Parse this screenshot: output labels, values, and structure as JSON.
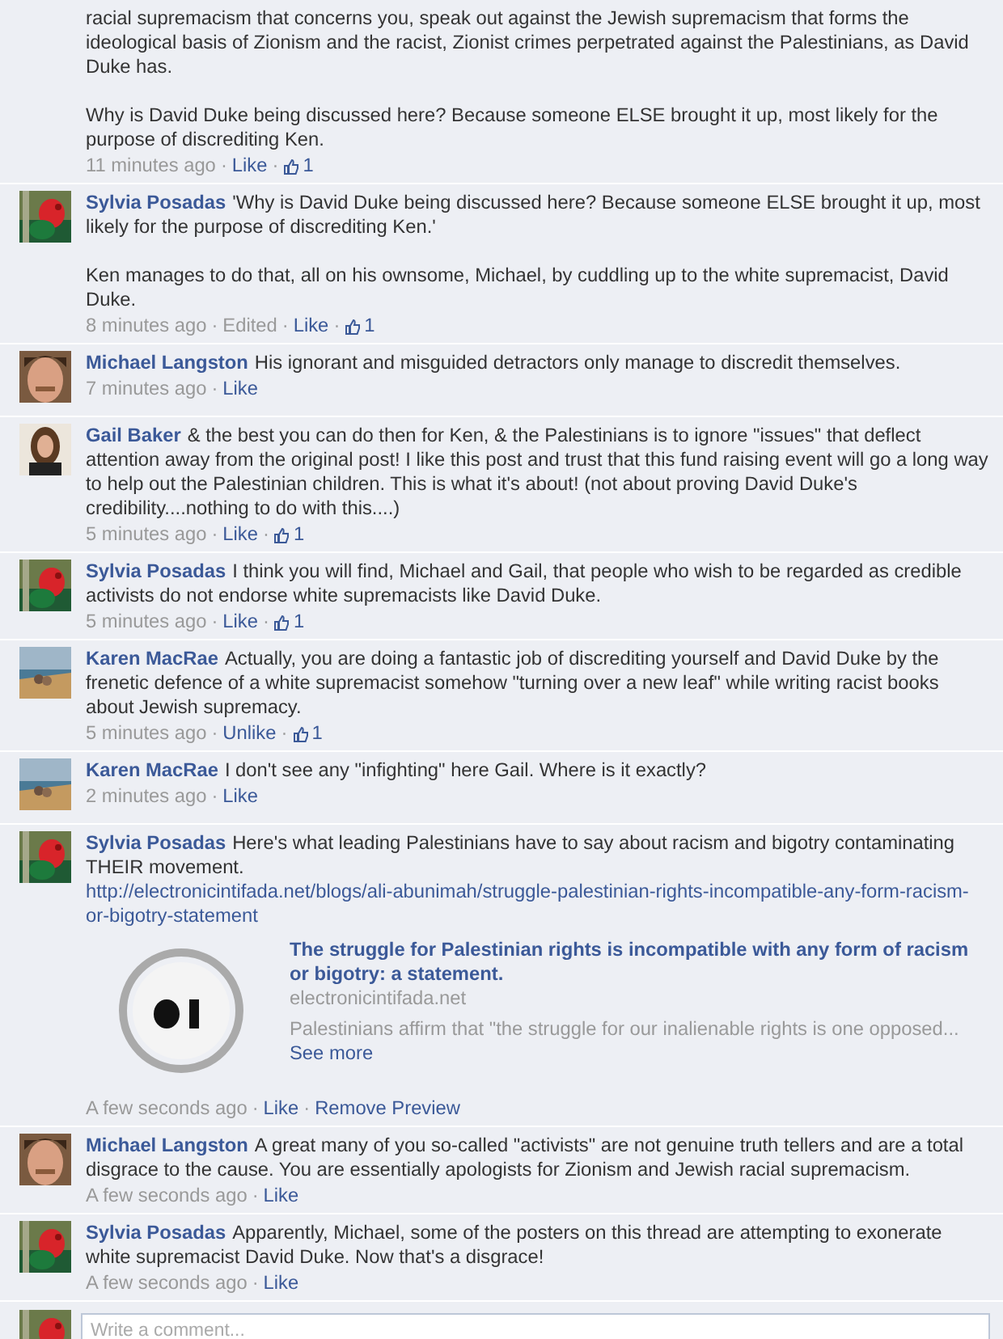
{
  "comments": [
    {
      "paragraphs": [
        "racial supremacism that concerns you, speak out against the Jewish supremacism that forms the ideological basis of Zionism and the racist, Zionist crimes perpetrated against the Palestinians, as David Duke has.",
        "Why is David Duke being discussed here? Because someone ELSE brought it up, most likely for the purpose of discrediting Ken."
      ],
      "time": "11 minutes ago",
      "edited": false,
      "like_action": "Like",
      "likes": "1"
    },
    {
      "author": "Sylvia Posadas",
      "paragraphs": [
        "'Why is David Duke being discussed here? Because someone ELSE brought it up, most likely for the purpose of discrediting Ken.'",
        "Ken manages to do that, all on his ownsome, Michael, by cuddling up to the white supremacist, David Duke."
      ],
      "time": "8 minutes ago",
      "edited": true,
      "edited_label": "Edited",
      "like_action": "Like",
      "likes": "1"
    },
    {
      "author": "Michael Langston",
      "paragraphs": [
        "His ignorant and misguided detractors only manage to discredit themselves."
      ],
      "time": "7 minutes ago",
      "edited": false,
      "like_action": "Like"
    },
    {
      "author": "Gail Baker",
      "paragraphs": [
        "& the best you can do then for Ken, & the Palestinians is to ignore \"issues\" that deflect attention away from the original post! I like this post and trust that this fund raising event will go a long way to help out the Palestinian children. This is what it's about! (not about proving David Duke's credibility....nothing to do with this....)"
      ],
      "time": "5 minutes ago",
      "edited": false,
      "like_action": "Like",
      "likes": "1"
    },
    {
      "author": "Sylvia Posadas",
      "paragraphs": [
        "I think you will find, Michael and Gail, that people who wish to be regarded as credible activists do not endorse white supremacists like David Duke."
      ],
      "time": "5 minutes ago",
      "edited": false,
      "like_action": "Like",
      "likes": "1"
    },
    {
      "author": "Karen MacRae",
      "paragraphs": [
        "Actually, you are doing a fantastic job of discrediting yourself and David Duke by the frenetic defence of a white supremacist somehow \"turning over a new leaf\" while writing racist books about Jewish supremacy."
      ],
      "time": "5 minutes ago",
      "edited": false,
      "like_action": "Unlike",
      "likes": "1"
    },
    {
      "author": "Karen MacRae",
      "paragraphs": [
        "I don't see any \"infighting\" here Gail. Where is it exactly?"
      ],
      "time": "2 minutes ago",
      "edited": false,
      "like_action": "Like"
    },
    {
      "author": "Sylvia Posadas",
      "paragraphs": [
        "Here's what leading Palestinians have to say about racism and bigotry contaminating THEIR movement."
      ],
      "link": "http://electronicintifada.net/blogs/ali-abunimah/struggle-palestinian-rights-incompatible-any-form-racism-or-bigotry-statement",
      "preview": {
        "title": "The struggle for Palestinian rights is incompatible with any form of racism or bigotry: a statement.",
        "domain": "electronicintifada.net",
        "summary": "Palestinians affirm that \"the struggle for our inalienable rights is one opposed...",
        "more": "See more"
      },
      "time": "A few seconds ago",
      "edited": false,
      "like_action": "Like",
      "extra_action": "Remove Preview"
    },
    {
      "author": "Michael Langston",
      "paragraphs": [
        "A great many of you so-called \"activists\" are not genuine truth tellers and are a total disgrace to the cause. You are essentially apologists for Zionism and Jewish racial supremacism."
      ],
      "time": "A few seconds ago",
      "edited": false,
      "like_action": "Like"
    },
    {
      "author": "Sylvia Posadas",
      "paragraphs": [
        "Apparently, Michael, some of the posters on this thread are attempting to exonerate white supremacist David Duke. Now that's a disgrace!"
      ],
      "time": "A few seconds ago",
      "edited": false,
      "like_action": "Like"
    }
  ],
  "separator": "·",
  "composer": {
    "placeholder": "Write a comment..."
  }
}
